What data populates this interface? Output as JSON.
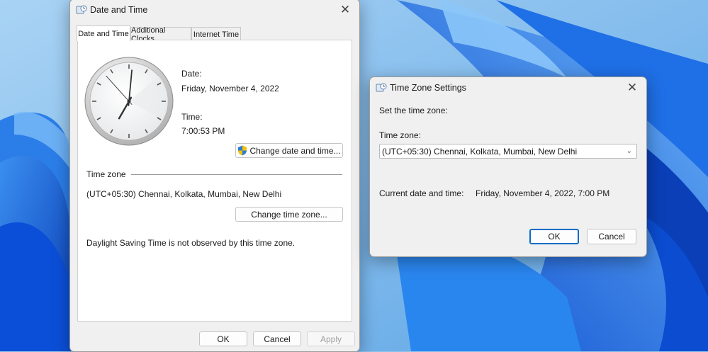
{
  "date_time_window": {
    "title": "Date and Time",
    "tabs": [
      {
        "label": "Date and Time",
        "active": true
      },
      {
        "label": "Additional Clocks",
        "active": false
      },
      {
        "label": "Internet Time",
        "active": false
      }
    ],
    "date_label": "Date:",
    "date_value": "Friday, November 4, 2022",
    "time_label": "Time:",
    "time_value": "7:00:53 PM",
    "change_datetime_button": "Change date and time...",
    "time_zone_heading": "Time zone",
    "time_zone_value": "(UTC+05:30) Chennai, Kolkata, Mumbai, New Delhi",
    "change_timezone_button": "Change time zone...",
    "dst_note": "Daylight Saving Time is not observed by this time zone.",
    "ok_button": "OK",
    "cancel_button": "Cancel",
    "apply_button": "Apply",
    "clock": {
      "hour": 7,
      "minute": 0,
      "second": 53
    }
  },
  "tz_window": {
    "title": "Time Zone Settings",
    "prompt": "Set the time zone:",
    "zone_label": "Time zone:",
    "selected_zone": "(UTC+05:30) Chennai, Kolkata, Mumbai, New Delhi",
    "current_label": "Current date and time:",
    "current_value": "Friday, November 4, 2022, 7:00 PM",
    "ok_button": "OK",
    "cancel_button": "Cancel"
  },
  "icons": {
    "window_icon": "clock-icon",
    "close": "close-icon",
    "shield": "uac-shield-icon",
    "dropdown": "chevron-down-icon"
  },
  "colors": {
    "wallpaper": "#1a6fe0",
    "window_bg": "#f0f0f0",
    "panel_bg": "#ffffff",
    "accent": "#0a6cc7"
  }
}
